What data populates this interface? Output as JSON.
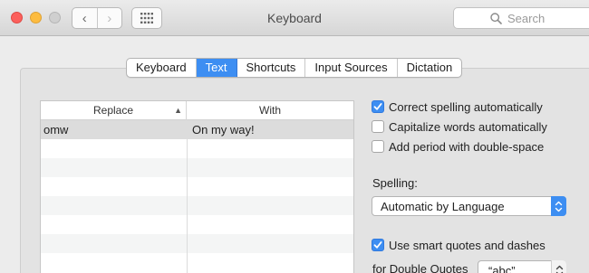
{
  "window": {
    "title": "Keyboard",
    "search_placeholder": "Search",
    "nav_back": "‹",
    "nav_forward": "›"
  },
  "tabs": [
    {
      "label": "Keyboard",
      "active": false
    },
    {
      "label": "Text",
      "active": true
    },
    {
      "label": "Shortcuts",
      "active": false
    },
    {
      "label": "Input Sources",
      "active": false
    },
    {
      "label": "Dictation",
      "active": false
    }
  ],
  "table": {
    "columns": [
      "Replace",
      "With"
    ],
    "sort_indicator": "▲",
    "rows": [
      {
        "replace": "omw",
        "with": "On my way!"
      }
    ]
  },
  "options": {
    "correct_spelling": {
      "label": "Correct spelling automatically",
      "checked": true
    },
    "capitalize_words": {
      "label": "Capitalize words automatically",
      "checked": false
    },
    "add_period": {
      "label": "Add period with double-space",
      "checked": false
    },
    "spelling_label": "Spelling:",
    "spelling_value": "Automatic by Language",
    "smart_quotes": {
      "label": "Use smart quotes and dashes",
      "checked": true
    },
    "double_quotes_label": "for Double Quotes",
    "double_quotes_value": "“abc”"
  },
  "colors": {
    "accent": "#3d8ef2",
    "close": "#fc605c",
    "minimize": "#fdbc40",
    "zoom_disabled": "#cfcfcf"
  }
}
